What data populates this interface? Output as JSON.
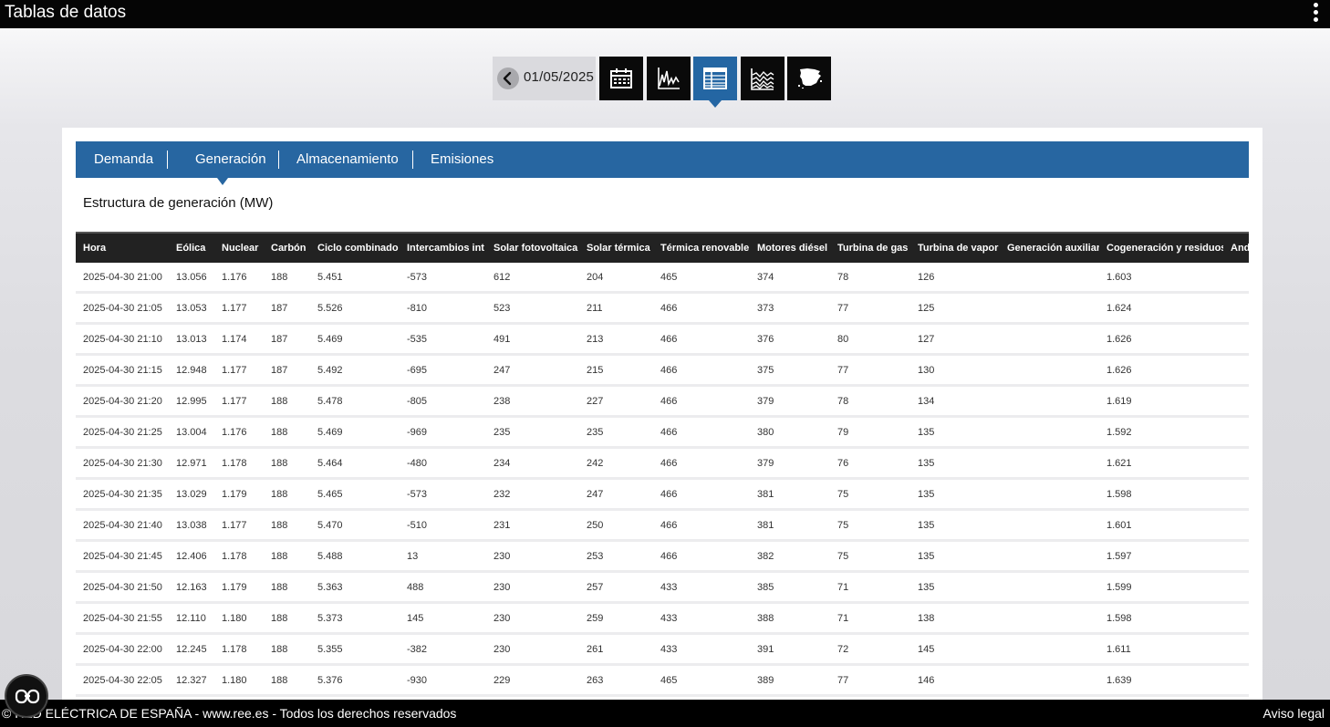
{
  "app": {
    "title": "Tablas de datos"
  },
  "toolbar": {
    "date": "01/05/2025",
    "buttons": [
      {
        "icon": "calendar-icon",
        "active": false
      },
      {
        "icon": "line-chart-icon",
        "active": false
      },
      {
        "icon": "table-icon",
        "active": true
      },
      {
        "icon": "stacked-area-chart-icon",
        "active": false
      },
      {
        "icon": "spain-map-icon",
        "active": false
      }
    ]
  },
  "tabs": [
    "Demanda",
    "Generación",
    "Almacenamiento",
    "Emisiones"
  ],
  "active_tab": "Generación",
  "section_title": "Estructura de generación (MW)",
  "table": {
    "columns": [
      "Hora",
      "Eólica",
      "Nuclear",
      "Carbón",
      "Ciclo combinado",
      "Intercambios int",
      "Solar fotovoltaica",
      "Solar térmica",
      "Térmica renovable",
      "Motores diésel",
      "Turbina de gas",
      "Turbina de vapor",
      "Generación auxiliar",
      "Cogeneración y residuos",
      "And"
    ],
    "rows": [
      [
        "2025-04-30 21:00",
        "13.056",
        "1.176",
        "188",
        "5.451",
        "-573",
        "612",
        "204",
        "465",
        "374",
        "78",
        "126",
        "",
        "1.603",
        ""
      ],
      [
        "2025-04-30 21:05",
        "13.053",
        "1.177",
        "187",
        "5.526",
        "-810",
        "523",
        "211",
        "466",
        "373",
        "77",
        "125",
        "",
        "1.624",
        ""
      ],
      [
        "2025-04-30 21:10",
        "13.013",
        "1.174",
        "187",
        "5.469",
        "-535",
        "491",
        "213",
        "466",
        "376",
        "80",
        "127",
        "",
        "1.626",
        ""
      ],
      [
        "2025-04-30 21:15",
        "12.948",
        "1.177",
        "187",
        "5.492",
        "-695",
        "247",
        "215",
        "466",
        "375",
        "77",
        "130",
        "",
        "1.626",
        ""
      ],
      [
        "2025-04-30 21:20",
        "12.995",
        "1.177",
        "188",
        "5.478",
        "-805",
        "238",
        "227",
        "466",
        "379",
        "78",
        "134",
        "",
        "1.619",
        ""
      ],
      [
        "2025-04-30 21:25",
        "13.004",
        "1.176",
        "188",
        "5.469",
        "-969",
        "235",
        "235",
        "466",
        "380",
        "79",
        "135",
        "",
        "1.592",
        ""
      ],
      [
        "2025-04-30 21:30",
        "12.971",
        "1.178",
        "188",
        "5.464",
        "-480",
        "234",
        "242",
        "466",
        "379",
        "76",
        "135",
        "",
        "1.621",
        ""
      ],
      [
        "2025-04-30 21:35",
        "13.029",
        "1.179",
        "188",
        "5.465",
        "-573",
        "232",
        "247",
        "466",
        "381",
        "75",
        "135",
        "",
        "1.598",
        ""
      ],
      [
        "2025-04-30 21:40",
        "13.038",
        "1.177",
        "188",
        "5.470",
        "-510",
        "231",
        "250",
        "466",
        "381",
        "75",
        "135",
        "",
        "1.601",
        ""
      ],
      [
        "2025-04-30 21:45",
        "12.406",
        "1.178",
        "188",
        "5.488",
        "13",
        "230",
        "253",
        "466",
        "382",
        "75",
        "135",
        "",
        "1.597",
        ""
      ],
      [
        "2025-04-30 21:50",
        "12.163",
        "1.179",
        "188",
        "5.363",
        "488",
        "230",
        "257",
        "433",
        "385",
        "71",
        "135",
        "",
        "1.599",
        ""
      ],
      [
        "2025-04-30 21:55",
        "12.110",
        "1.180",
        "188",
        "5.373",
        "145",
        "230",
        "259",
        "433",
        "388",
        "71",
        "138",
        "",
        "1.598",
        ""
      ],
      [
        "2025-04-30 22:00",
        "12.245",
        "1.178",
        "188",
        "5.355",
        "-382",
        "230",
        "261",
        "433",
        "391",
        "72",
        "145",
        "",
        "1.611",
        ""
      ],
      [
        "2025-04-30 22:05",
        "12.327",
        "1.180",
        "188",
        "5.376",
        "-930",
        "229",
        "263",
        "465",
        "389",
        "77",
        "146",
        "",
        "1.639",
        ""
      ]
    ]
  },
  "footer": {
    "copyright": "© RED ELÉCTRICA DE ESPAÑA - www.ree.es - Todos los derechos reservados",
    "legal_link": "Aviso legal"
  },
  "colors": {
    "tab_bar": "#2766a1",
    "active_button": "#2466a3",
    "header_bg": "#222222"
  }
}
